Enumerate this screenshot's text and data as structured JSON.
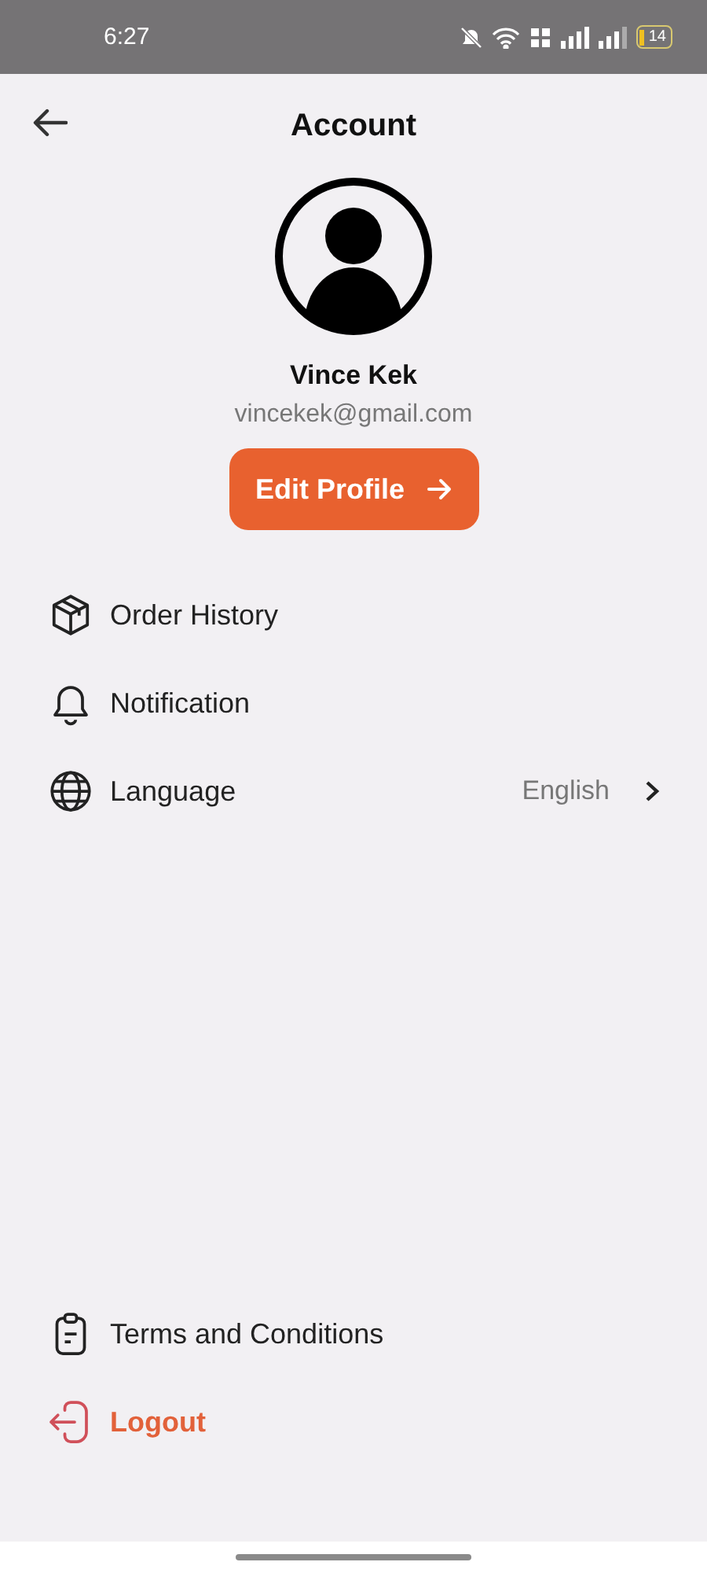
{
  "status_bar": {
    "time": "6:27",
    "battery": "14"
  },
  "header": {
    "title": "Account"
  },
  "profile": {
    "name": "Vince Kek",
    "email": "vincekek@gmail.com",
    "button": "Edit Profile"
  },
  "menu": [
    {
      "kind": "box",
      "label": "Order History"
    },
    {
      "kind": "bell",
      "label": "Notification"
    },
    {
      "kind": "globe",
      "label": "Language",
      "value": "English"
    }
  ],
  "footer_menu": [
    {
      "kind": "clipboard",
      "label": "Terms and Conditions",
      "danger": false
    },
    {
      "kind": "logout",
      "label": "Logout",
      "danger": true
    }
  ]
}
